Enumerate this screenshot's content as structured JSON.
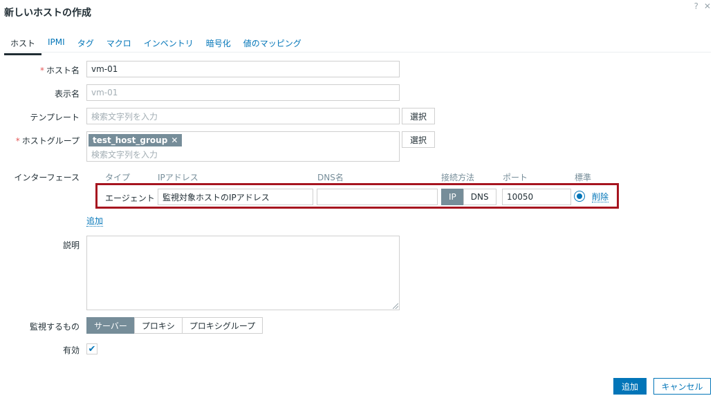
{
  "dialog": {
    "title": "新しいホストの作成",
    "help_icon": "?",
    "close_icon": "✕"
  },
  "tabs": [
    {
      "label": "ホスト",
      "active": true
    },
    {
      "label": "IPMI"
    },
    {
      "label": "タグ"
    },
    {
      "label": "マクロ"
    },
    {
      "label": "インベントリ"
    },
    {
      "label": "暗号化"
    },
    {
      "label": "値のマッピング"
    }
  ],
  "form": {
    "required_mark": "*",
    "host_name": {
      "label": "ホスト名",
      "value": "vm-01"
    },
    "visible_name": {
      "label": "表示名",
      "placeholder": "vm-01"
    },
    "templates": {
      "label": "テンプレート",
      "placeholder": "検索文字列を入力",
      "select_label": "選択"
    },
    "host_groups": {
      "label": "ホストグループ",
      "chips": [
        "test_host_group"
      ],
      "chip_remove": "✕",
      "placeholder": "検索文字列を入力",
      "select_label": "選択"
    },
    "interfaces": {
      "label": "インターフェース",
      "headers": {
        "type": "タイプ",
        "ip": "IPアドレス",
        "dns": "DNS名",
        "connect": "接続方法",
        "port": "ポート",
        "default": "標準"
      },
      "rows": [
        {
          "type": "エージェント",
          "ip": "監視対象ホストのIPアドレス",
          "dns": "",
          "connect_ip": "IP",
          "connect_dns": "DNS",
          "port": "10050",
          "remove": "削除"
        }
      ],
      "add_label": "追加"
    },
    "description": {
      "label": "説明",
      "value": ""
    },
    "monitored_by": {
      "label": "監視するもの",
      "options": [
        "サーバー",
        "プロキシ",
        "プロキシグループ"
      ],
      "selected": 0
    },
    "enabled": {
      "label": "有効",
      "checked": true,
      "check_glyph": "✔"
    }
  },
  "footer": {
    "add_label": "追加",
    "cancel_label": "キャンセル"
  },
  "colors": {
    "accent": "#0275b8",
    "highlight": "#a6141f",
    "selected": "#768d99",
    "required": "#e45959"
  },
  "icons": {
    "help": "help-icon",
    "close": "close-icon",
    "chip_remove": "remove-icon",
    "resize": "resize-handle-icon",
    "check": "checkmark-icon"
  }
}
